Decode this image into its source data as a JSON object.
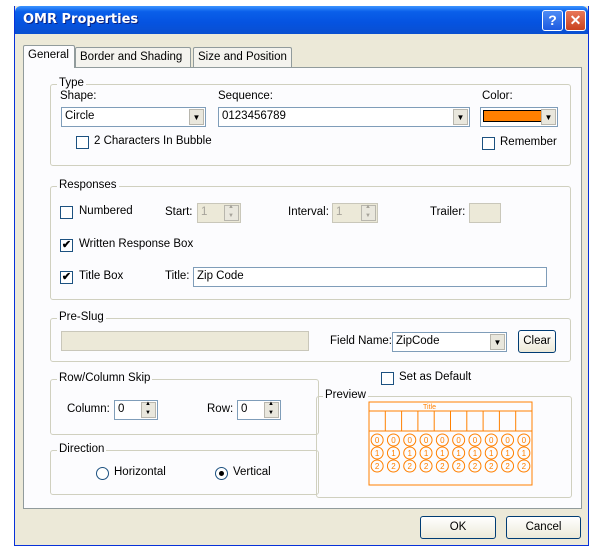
{
  "window": {
    "title": "OMR Properties",
    "help_glyph": "?",
    "close_glyph": "✕"
  },
  "tabs": [
    "General",
    "Border and Shading",
    "Size and Position"
  ],
  "type_group": {
    "legend": "Type",
    "shape_label": "Shape:",
    "shape_value": "Circle",
    "sequence_label": "Sequence:",
    "sequence_value": "0123456789",
    "color_label": "Color:",
    "color_value": "#ff8000",
    "two_chars_label": "2 Characters In Bubble",
    "two_chars_checked": false,
    "remember_label": "Remember",
    "remember_checked": false
  },
  "responses": {
    "legend": "Responses",
    "numbered_label": "Numbered",
    "numbered_checked": false,
    "start_label": "Start:",
    "start_value": "1",
    "interval_label": "Interval:",
    "interval_value": "1",
    "trailer_label": "Trailer:",
    "trailer_value": "",
    "written_label": "Written Response Box",
    "written_checked": true,
    "titlebox_label": "Title Box",
    "titlebox_checked": true,
    "title_label": "Title:",
    "title_value": "Zip Code",
    "check_glyph": "✔"
  },
  "preslug": {
    "legend": "Pre-Slug",
    "value": "",
    "field_name_label": "Field Name:",
    "field_name_value": "ZipCode",
    "clear_label": "Clear"
  },
  "skip": {
    "legend": "Row/Column Skip",
    "column_label": "Column:",
    "column_value": "0",
    "row_label": "Row:",
    "row_value": "0"
  },
  "direction": {
    "legend": "Direction",
    "horizontal_label": "Horizontal",
    "vertical_label": "Vertical",
    "selected": "Vertical"
  },
  "set_default": {
    "label": "Set as Default",
    "checked": false
  },
  "preview": {
    "legend": "Preview",
    "title_text": "Title",
    "columns": 10,
    "bubble_rows": [
      "0",
      "1",
      "2"
    ],
    "accent": "#ff8000"
  },
  "footer": {
    "ok_label": "OK",
    "cancel_label": "Cancel"
  }
}
